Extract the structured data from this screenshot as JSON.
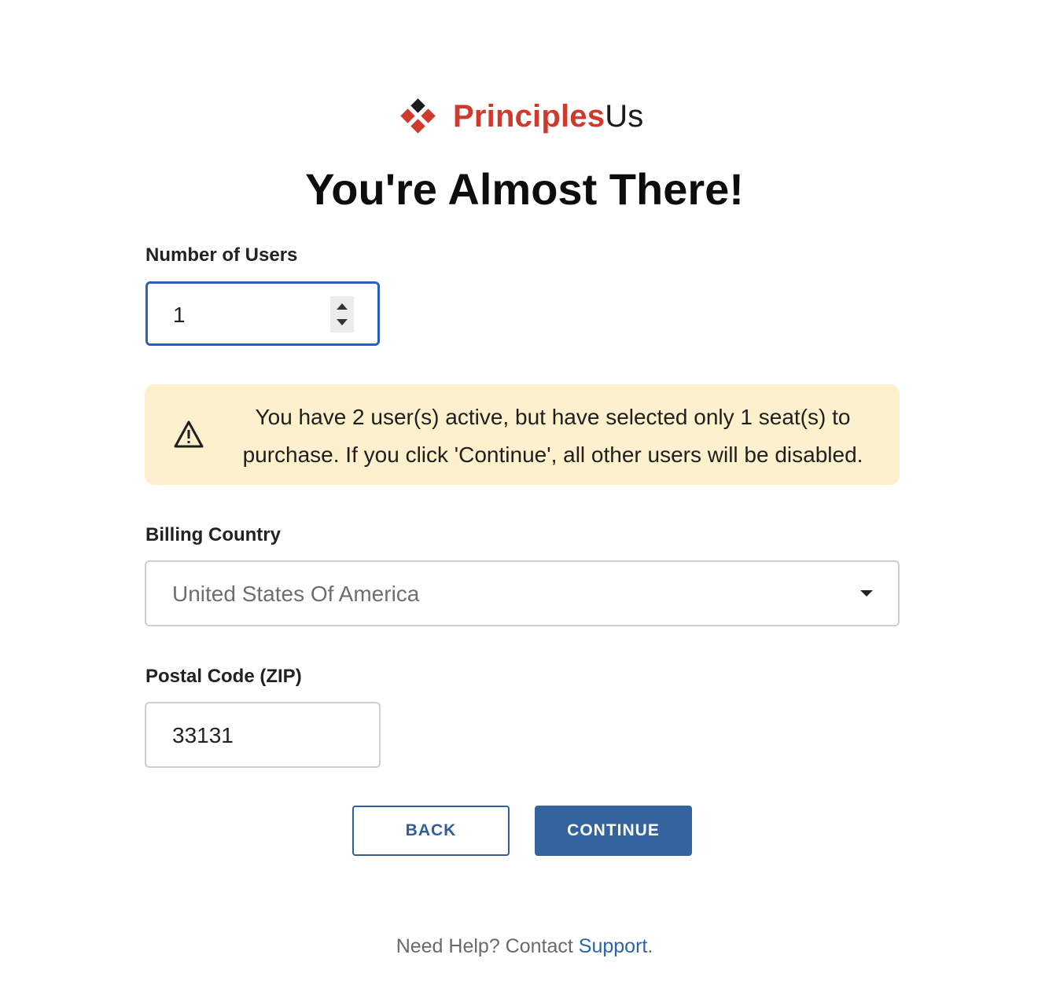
{
  "brand": {
    "name_part1": "Principles",
    "name_part2": "Us"
  },
  "heading": "You're Almost There!",
  "users_field": {
    "label": "Number of Users",
    "value": "1"
  },
  "alert": {
    "icon": "warning-icon",
    "message": "You have 2 user(s) active, but have selected only 1 seat(s) to purchase. If you click 'Continue', all other users will be disabled."
  },
  "country_field": {
    "label": "Billing Country",
    "value": "United States Of America"
  },
  "zip_field": {
    "label": "Postal Code (ZIP)",
    "value": "33131"
  },
  "buttons": {
    "back": "BACK",
    "continue": "CONTINUE"
  },
  "footer": {
    "text": "Need Help? Contact ",
    "link": "Support",
    "suffix": "."
  },
  "colors": {
    "brand_red": "#d03a2c",
    "primary_blue": "#34649d",
    "alert_bg": "#fdf0cc",
    "focus_blue": "#2b5fbf"
  }
}
